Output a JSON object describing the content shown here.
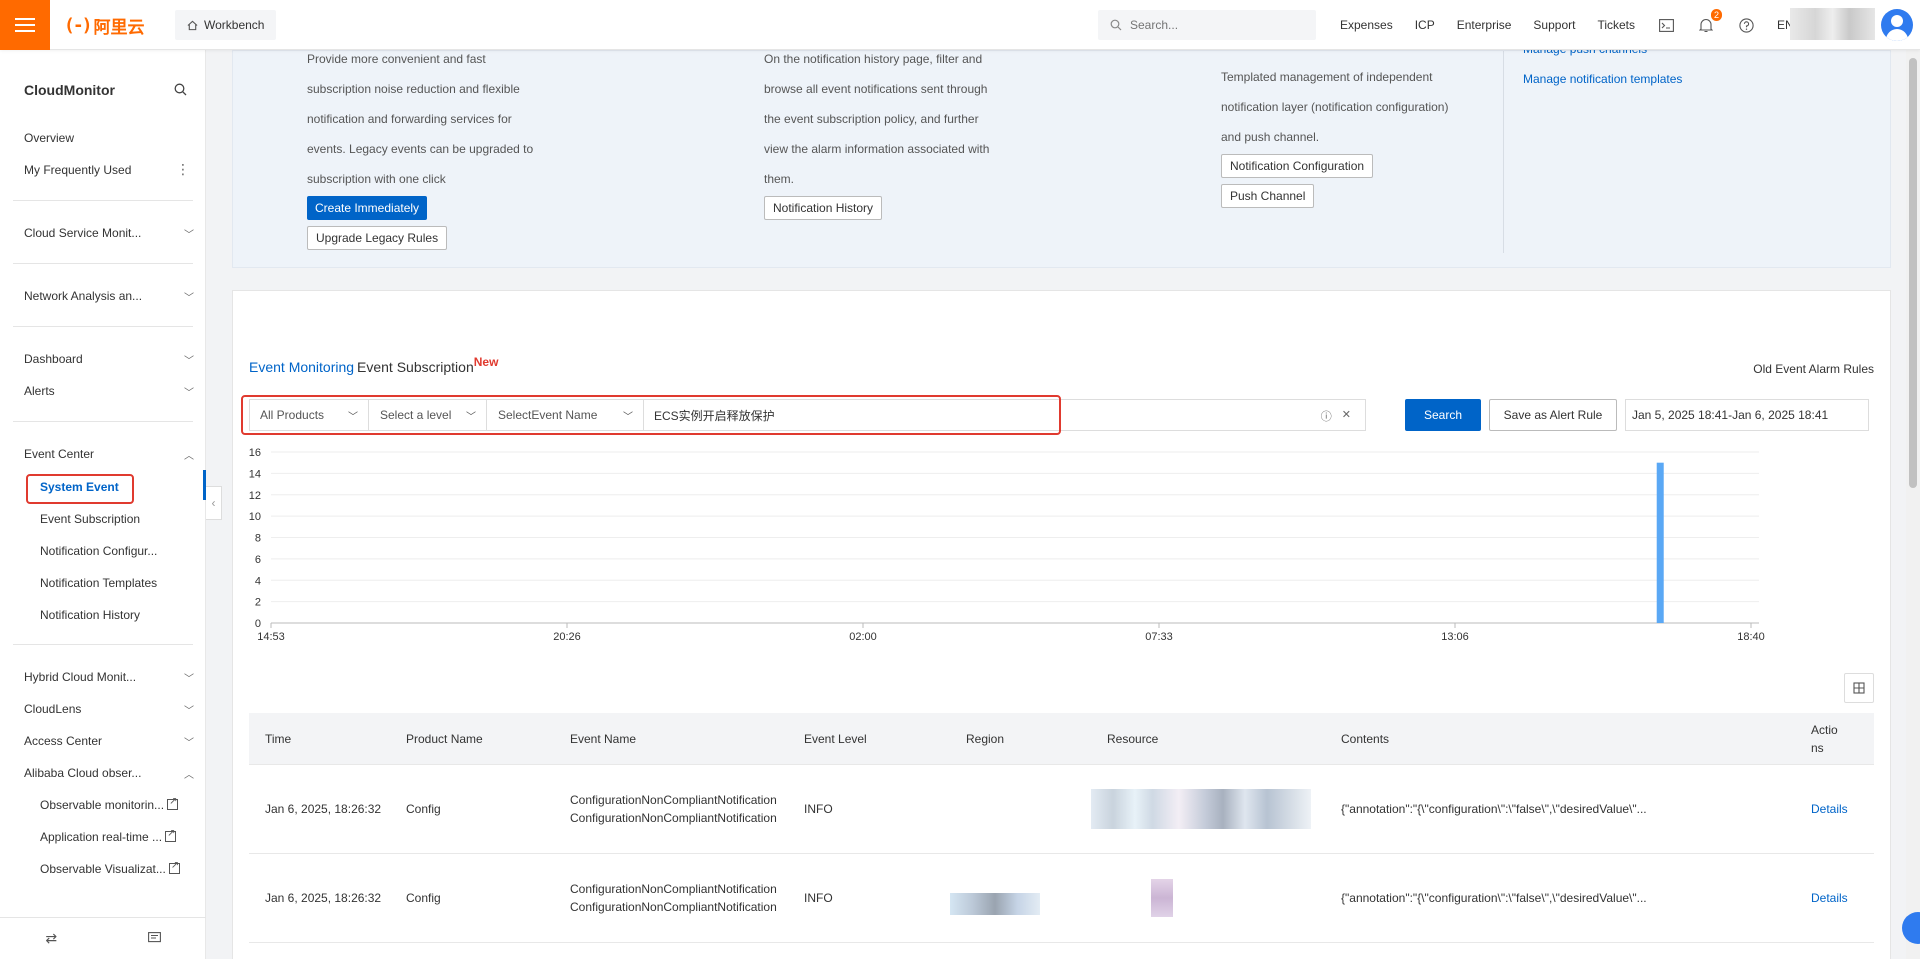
{
  "topbar": {
    "logo_text": "阿里云",
    "logo_mark": "(-)",
    "workbench": "Workbench",
    "search_placeholder": "Search...",
    "links": [
      "Expenses",
      "ICP",
      "Enterprise",
      "Support",
      "Tickets"
    ],
    "notification_count": "2",
    "lang": "EN",
    "accent": "#ff6a00"
  },
  "sidebar": {
    "title": "CloudMonitor",
    "items": {
      "overview": "Overview",
      "frequent": "My Frequently Used",
      "cloud_service": "Cloud Service Monit...",
      "network": "Network Analysis an...",
      "dashboard": "Dashboard",
      "alerts": "Alerts",
      "event_center": "Event Center",
      "hybrid": "Hybrid Cloud Monit...",
      "cloudlens": "CloudLens",
      "access": "Access Center",
      "observability": "Alibaba Cloud obser..."
    },
    "event_sub": [
      "System Event",
      "Event Subscription",
      "Notification Configur...",
      "Notification Templates",
      "Notification History"
    ],
    "obs_sub": [
      "Observable monitorin...",
      "Application real-time ...",
      "Observable Visualizat..."
    ]
  },
  "info": {
    "col1_lines": [
      "Provide more convenient and fast",
      "subscription noise reduction and flexible",
      "notification and forwarding services for",
      "events. Legacy events can be upgraded to",
      "subscription with one click"
    ],
    "create_btn": "Create Immediately",
    "upgrade_btn": "Upgrade Legacy Rules",
    "col2_lines": [
      "On the notification history page, filter and",
      "browse all event notifications sent through",
      "the event subscription policy, and further",
      "view the alarm information associated with",
      "them."
    ],
    "history_btn": "Notification History",
    "col3_lines": [
      "Templated management of independent",
      "notification layer (notification configuration)",
      "and push channel."
    ],
    "config_btn": "Notification Configuration",
    "push_btn": "Push Channel",
    "link_push": "Manage push channels",
    "link_templates": "Manage notification templates"
  },
  "tabs": {
    "event_monitoring": "Event Monitoring",
    "event_subscription": "Event Subscription",
    "new_badge": "New",
    "old_rules": "Old Event Alarm Rules"
  },
  "filters": {
    "product": "All Products",
    "level": "Select a level",
    "event_name": "SelectEvent Name",
    "query": "ECS实例开启释放保护",
    "search_btn": "Search",
    "save_rule_btn": "Save as Alert Rule",
    "date_range": "Jan 5, 2025 18:41-Jan 6, 2025 18:41"
  },
  "chart_data": {
    "type": "bar",
    "y_ticks": [
      0,
      2,
      4,
      6,
      8,
      10,
      12,
      14,
      16
    ],
    "ylim": [
      0,
      16
    ],
    "x_ticks": [
      "14:53",
      "20:26",
      "02:00",
      "07:33",
      "13:06",
      "18:40"
    ],
    "bars": [
      {
        "x": "18:26",
        "value": 15
      }
    ],
    "color": "#5aa8f5",
    "grid": true
  },
  "table": {
    "headers": [
      "Time",
      "Product Name",
      "Event Name",
      "Event Level",
      "Region",
      "Resource",
      "Contents",
      "Actions"
    ],
    "rows": [
      {
        "time": "Jan 6, 2025, 18:26:32",
        "product": "Config",
        "event": "ConfigurationNonCompliantNotification ConfigurationNonCompliantNotification",
        "level": "INFO",
        "contents": "{\"annotation\":\"{\\\"configuration\\\":\\\"false\\\",\\\"desiredValue\\\"...",
        "action": "Details"
      },
      {
        "time": "Jan 6, 2025, 18:26:32",
        "product": "Config",
        "event": "ConfigurationNonCompliantNotification ConfigurationNonCompliantNotification",
        "level": "INFO",
        "contents": "{\"annotation\":\"{\\\"configuration\\\":\\\"false\\\",\\\"desiredValue\\\"...",
        "action": "Details"
      }
    ]
  }
}
